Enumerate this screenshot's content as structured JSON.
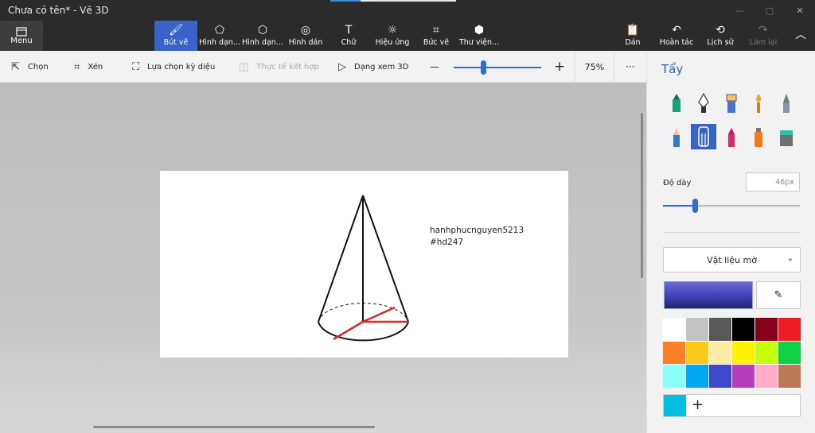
{
  "window": {
    "title": "Chưa có tên* - Vẽ 3D"
  },
  "ribbon": {
    "menu_label": "Menu",
    "tools": [
      {
        "label": "Bút vẽ",
        "icon": "brush-icon",
        "active": true
      },
      {
        "label": "Hình dạn...",
        "icon": "shapes-2d-icon"
      },
      {
        "label": "Hình dạn...",
        "icon": "shapes-3d-icon"
      },
      {
        "label": "Hình dán",
        "icon": "sticker-icon"
      },
      {
        "label": "Chữ",
        "icon": "text-icon"
      },
      {
        "label": "Hiệu ứng",
        "icon": "effects-icon"
      },
      {
        "label": "Bức vẽ",
        "icon": "canvas-icon"
      },
      {
        "label": "Thư viện...",
        "icon": "library-icon"
      }
    ],
    "right_tools": [
      {
        "label": "Dán",
        "icon": "paste-icon"
      },
      {
        "label": "Hoàn tác",
        "icon": "undo-icon"
      },
      {
        "label": "Lịch sử",
        "icon": "history-icon"
      },
      {
        "label": "Làm lại",
        "icon": "redo-icon",
        "disabled": true
      }
    ]
  },
  "toolbar": {
    "select_label": "Chọn",
    "crop_label": "Xén",
    "magic_select_label": "Lựa chọn kỳ diệu",
    "mixed_reality_label": "Thực tế kết hợp",
    "view3d_label": "Dạng xem 3D",
    "zoom_minus": "—",
    "zoom_plus": "+",
    "zoom_value": "75%",
    "zoom_fraction": 0.34,
    "more_label": "···"
  },
  "canvas": {
    "text_line1": "hanhphucnguyen5213",
    "text_line2": "#hd247"
  },
  "panel": {
    "title": "Tẩy",
    "brushes": [
      {
        "icon": "marker-icon"
      },
      {
        "icon": "calligraphy-pen-icon"
      },
      {
        "icon": "oil-brush-icon"
      },
      {
        "icon": "watercolor-icon"
      },
      {
        "icon": "pixel-pen-icon"
      },
      {
        "icon": "pencil-icon"
      },
      {
        "icon": "eraser-icon",
        "selected": true
      },
      {
        "icon": "crayon-icon"
      },
      {
        "icon": "spray-can-icon"
      },
      {
        "icon": "fill-bucket-icon"
      }
    ],
    "thickness_label": "Độ dày",
    "thickness_value": "46px",
    "thickness_fraction": 0.23,
    "material_label": "Vật liệu mờ",
    "current_color": "#3c3cb0",
    "palette": [
      "#ffffff",
      "#c3c3c3",
      "#585858",
      "#000000",
      "#88001b",
      "#ec1c24",
      "#ff7f27",
      "#ffca18",
      "#fdeca6",
      "#fff200",
      "#c4ff0e",
      "#0ed145",
      "#8cfffb",
      "#00a8f3",
      "#3f48cc",
      "#b83dba",
      "#ffaec8",
      "#b97a56"
    ],
    "custom_color": "#00bfe0",
    "add_color_label": "+"
  }
}
